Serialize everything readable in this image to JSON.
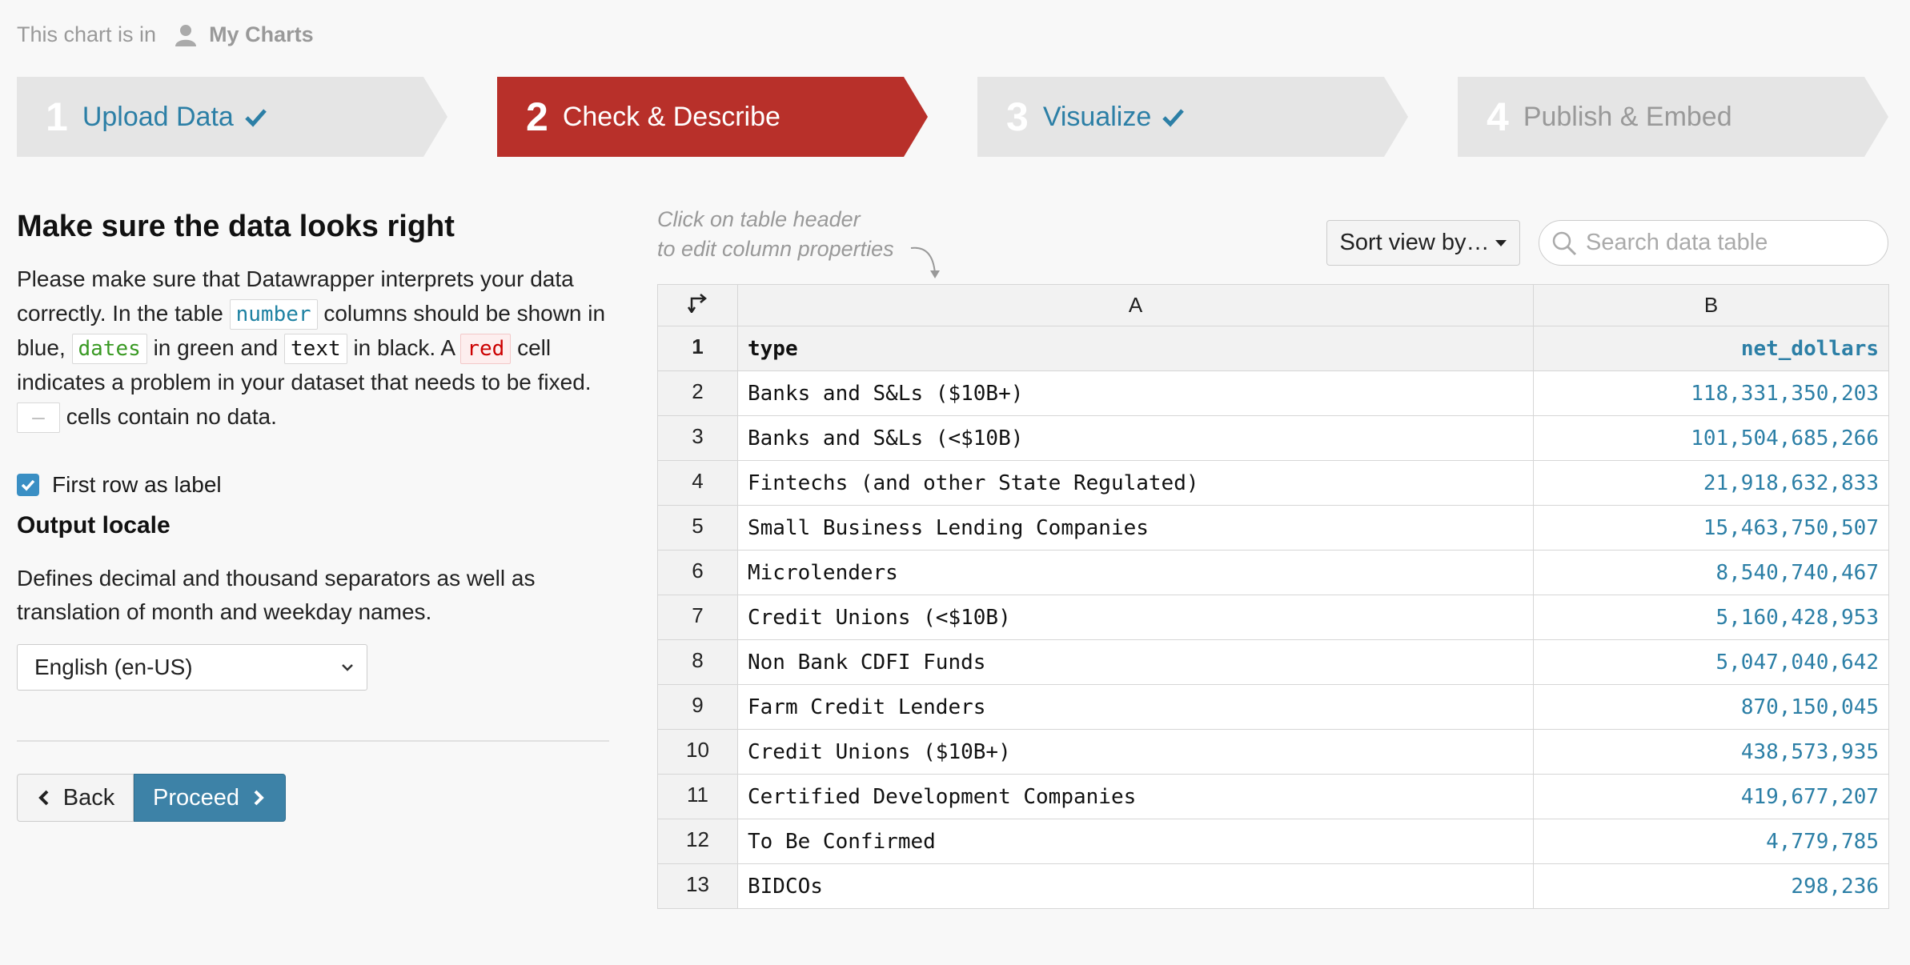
{
  "breadcrumb": {
    "prefix": "This chart is in",
    "folder": "My Charts"
  },
  "steps": [
    {
      "num": "1",
      "label": "Upload Data",
      "state": "done"
    },
    {
      "num": "2",
      "label": "Check & Describe",
      "state": "active"
    },
    {
      "num": "3",
      "label": "Visualize",
      "state": "done"
    },
    {
      "num": "4",
      "label": "Publish & Embed",
      "state": "todo"
    }
  ],
  "colors": {
    "active_step": "#b8302a",
    "inactive_step": "#e5e5e5",
    "accent": "#2c7fa6",
    "proceed": "#3d82a7"
  },
  "left": {
    "title": "Make sure the data looks right",
    "intro": {
      "p1": "Please make sure that Datawrapper interprets your data correctly. In the table",
      "number_tag": "number",
      "p2": "columns should be shown in blue,",
      "dates_tag": "dates",
      "p3": "in green and",
      "text_tag": "text",
      "p4": "in black. A",
      "red_tag": "red",
      "p5": "cell indicates a problem in your dataset that needs to be fixed.",
      "empty_tag": "—",
      "p6": "cells contain no data."
    },
    "first_row_label": "First row as label",
    "first_row_checked": true,
    "locale_heading": "Output locale",
    "locale_desc": "Defines decimal and thousand separators as well as translation of month and weekday names.",
    "locale_value": "English (en-US)",
    "back_label": "Back",
    "proceed_label": "Proceed"
  },
  "right": {
    "hint_line1": "Click on table header",
    "hint_line2": "to edit column properties",
    "sort_label": "Sort view by…",
    "search_placeholder": "Search data table",
    "columns": [
      "A",
      "B"
    ],
    "rows": [
      {
        "n": "1",
        "a": "type",
        "b": "net_dollars"
      },
      {
        "n": "2",
        "a": "Banks and S&Ls ($10B+)",
        "b": "118,331,350,203"
      },
      {
        "n": "3",
        "a": "Banks and S&Ls (<$10B)",
        "b": "101,504,685,266"
      },
      {
        "n": "4",
        "a": "Fintechs (and other State Regulated)",
        "b": "21,918,632,833"
      },
      {
        "n": "5",
        "a": "Small Business Lending Companies",
        "b": "15,463,750,507"
      },
      {
        "n": "6",
        "a": "Microlenders",
        "b": "8,540,740,467"
      },
      {
        "n": "7",
        "a": "Credit Unions (<$10B)",
        "b": "5,160,428,953"
      },
      {
        "n": "8",
        "a": "Non Bank CDFI Funds",
        "b": "5,047,040,642"
      },
      {
        "n": "9",
        "a": "Farm Credit Lenders",
        "b": "870,150,045"
      },
      {
        "n": "10",
        "a": "Credit Unions ($10B+)",
        "b": "438,573,935"
      },
      {
        "n": "11",
        "a": "Certified Development Companies",
        "b": "419,677,207"
      },
      {
        "n": "12",
        "a": "To Be Confirmed",
        "b": "4,779,785"
      },
      {
        "n": "13",
        "a": "BIDCOs",
        "b": "298,236"
      }
    ]
  }
}
